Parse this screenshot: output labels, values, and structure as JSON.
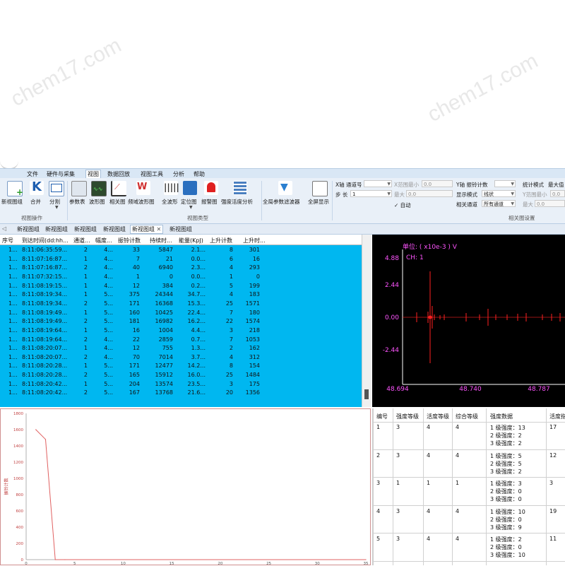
{
  "watermark": "chem17.com",
  "menu": {
    "items": [
      "文件",
      "硬件与采集",
      "视图",
      "数据回放",
      "视图工具",
      "分析",
      "帮助"
    ],
    "active": "视图"
  },
  "ribbon": {
    "btn_new_group": "新视图组",
    "btn_merge": "合并",
    "btn_split": "分割",
    "group_view_ops": "视图操作",
    "btn_param_table": "参数表",
    "btn_waveform": "波形图",
    "btn_correlation": "相关图",
    "btn_freq_wave": "频域波形图",
    "btn_full_wave": "全波形",
    "btn_locate": "定位图",
    "btn_alarm": "报警图",
    "btn_intensity": "强度活度分析",
    "group_view_type": "视图类型",
    "btn_global_filter": "全局参数滤波器",
    "btn_fullscreen": "全屏显示",
    "group_corr_settings": "相关图设置",
    "x_channel_label": "X轴 通道号",
    "x_range_min_label": "X范围最小",
    "x_range_min_value": "0.0",
    "step_label": "步 长",
    "step_value": "1",
    "x_range_max_label": "最大",
    "x_range_max_value": "0.0",
    "auto_label": "自动",
    "y_axis_label": "Y轴 振铃计数",
    "display_mode_label": "显示模式",
    "display_mode_value": "线状",
    "related_channel_label": "相关通道",
    "related_channel_value": "所有通道",
    "stat_mode_label": "统计模式",
    "stat_mode_value": "最大值",
    "y_range_min_label": "Y范围最小",
    "y_range_min_value": "0.0",
    "y_range_max_label": "最大",
    "y_range_max_value": "0.0"
  },
  "tabs": [
    "新视图组",
    "新视图组",
    "新视图组",
    "新视图组",
    "新视图组",
    "新视图组"
  ],
  "table": {
    "headers": [
      "序号",
      "到达时间(dd:hh...",
      "通道...",
      "幅度...",
      "振铃计数",
      "持续时...",
      "能量(KpJ)",
      "上升计数",
      "上升时..."
    ],
    "rows": [
      [
        "1...",
        "8:11:06:35:59...",
        "2",
        "4...",
        "33",
        "5847",
        "2.1...",
        "8",
        "301"
      ],
      [
        "1...",
        "8:11:07:16:87...",
        "1",
        "4...",
        "7",
        "21",
        "0.0...",
        "6",
        "16"
      ],
      [
        "1...",
        "8:11:07:16:87...",
        "2",
        "4...",
        "40",
        "6940",
        "2.3...",
        "4",
        "293"
      ],
      [
        "1...",
        "8:11:07:32:15...",
        "1",
        "4...",
        "1",
        "0",
        "0.0...",
        "1",
        "0"
      ],
      [
        "1...",
        "8:11:08:19:15...",
        "1",
        "4...",
        "12",
        "384",
        "0.2...",
        "5",
        "199"
      ],
      [
        "1...",
        "8:11:08:19:34...",
        "1",
        "5...",
        "375",
        "24344",
        "34.7...",
        "4",
        "183"
      ],
      [
        "1...",
        "8:11:08:19:34...",
        "2",
        "5...",
        "171",
        "16368",
        "15.3...",
        "25",
        "1571"
      ],
      [
        "1...",
        "8:11:08:19:49...",
        "1",
        "5...",
        "160",
        "10425",
        "22.4...",
        "7",
        "180"
      ],
      [
        "1...",
        "8:11:08:19:49...",
        "2",
        "5...",
        "181",
        "16982",
        "16.2...",
        "22",
        "1574"
      ],
      [
        "1...",
        "8:11:08:19:64...",
        "1",
        "5...",
        "16",
        "1004",
        "4.4...",
        "3",
        "218"
      ],
      [
        "1...",
        "8:11:08:19:64...",
        "2",
        "4...",
        "22",
        "2859",
        "0.7...",
        "7",
        "1053"
      ],
      [
        "1...",
        "8:11:08:20:07...",
        "1",
        "4...",
        "12",
        "755",
        "1.3...",
        "2",
        "162"
      ],
      [
        "1...",
        "8:11:08:20:07...",
        "2",
        "4...",
        "70",
        "7014",
        "3.7...",
        "4",
        "312"
      ],
      [
        "1...",
        "8:11:08:20:28...",
        "1",
        "5...",
        "171",
        "12477",
        "14.2...",
        "8",
        "154"
      ],
      [
        "1...",
        "8:11:08:20:28...",
        "2",
        "5...",
        "165",
        "15912",
        "16.0...",
        "25",
        "1484"
      ],
      [
        "1...",
        "8:11:08:20:42...",
        "1",
        "5...",
        "204",
        "13574",
        "23.5...",
        "3",
        "175"
      ],
      [
        "1...",
        "8:11:08:20:42...",
        "2",
        "5...",
        "167",
        "13768",
        "21.6...",
        "20",
        "1356"
      ]
    ]
  },
  "waveform": {
    "unit_label": "单位: ( x10e-3 ) V",
    "channel_label": "CH:  1",
    "y_ticks": [
      "4.88",
      "2.44",
      "0.00",
      "-2.44"
    ],
    "x_ticks": [
      "48.694",
      "48.740",
      "48.787"
    ],
    "colors": {
      "bg": "#000000",
      "axis": "#ffffff",
      "tick": "#ff55ff",
      "signal": "#ff2020"
    }
  },
  "stats": {
    "headers": [
      "编号",
      "强度等级",
      "活度等级",
      "综合等级",
      "强度数据",
      "活度指"
    ],
    "rows": [
      {
        "id": "1",
        "intensity": "3",
        "activity": "4",
        "overall": "4",
        "data": [
          "1 级强度：13",
          "2 级强度：2",
          "3 级强度：2"
        ],
        "extra": "17"
      },
      {
        "id": "2",
        "intensity": "3",
        "activity": "4",
        "overall": "4",
        "data": [
          "1 级强度：5",
          "2 级强度：5",
          "3 级强度：2"
        ],
        "extra": "12"
      },
      {
        "id": "3",
        "intensity": "1",
        "activity": "1",
        "overall": "1",
        "data": [
          "1 级强度：3",
          "2 级强度：0",
          "3 级强度：0"
        ],
        "extra": "3"
      },
      {
        "id": "4",
        "intensity": "3",
        "activity": "4",
        "overall": "4",
        "data": [
          "1 级强度：10",
          "2 级强度：0",
          "3 级强度：9"
        ],
        "extra": "19"
      },
      {
        "id": "5",
        "intensity": "3",
        "activity": "4",
        "overall": "4",
        "data": [
          "1 级强度：2",
          "2 级强度：0",
          "3 级强度：10"
        ],
        "extra": "11"
      }
    ]
  },
  "chart_data": {
    "type": "line",
    "title": "",
    "xlabel": "",
    "ylabel": "振铃计数",
    "xlim": [
      0,
      35
    ],
    "ylim": [
      0,
      1800
    ],
    "x_ticks": [
      0,
      5,
      10,
      15,
      20,
      25,
      30,
      35
    ],
    "y_ticks": [
      0,
      200,
      400,
      600,
      800,
      1000,
      1200,
      1400,
      1600,
      1800
    ],
    "series": [
      {
        "x": [
          1,
          2,
          3,
          4,
          35
        ],
        "y": [
          1600,
          1480,
          0,
          0,
          0
        ]
      }
    ],
    "color": "#e06060",
    "grid": false
  }
}
